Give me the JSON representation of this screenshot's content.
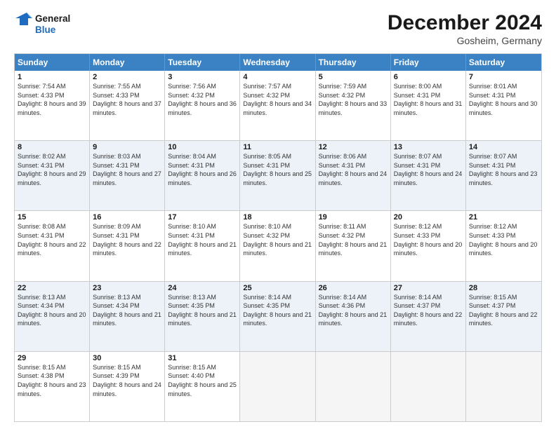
{
  "header": {
    "logo_general": "General",
    "logo_blue": "Blue",
    "month_title": "December 2024",
    "location": "Gosheim, Germany"
  },
  "calendar": {
    "days_of_week": [
      "Sunday",
      "Monday",
      "Tuesday",
      "Wednesday",
      "Thursday",
      "Friday",
      "Saturday"
    ],
    "weeks": [
      [
        {
          "day": "",
          "empty": true
        },
        {
          "day": "",
          "empty": true
        },
        {
          "day": "",
          "empty": true
        },
        {
          "day": "",
          "empty": true
        },
        {
          "day": "",
          "empty": true
        },
        {
          "day": "",
          "empty": true
        },
        {
          "day": "",
          "empty": true
        }
      ],
      [
        {
          "day": "1",
          "sunrise": "7:54 AM",
          "sunset": "4:33 PM",
          "daylight": "8 hours and 39 minutes."
        },
        {
          "day": "2",
          "sunrise": "7:55 AM",
          "sunset": "4:33 PM",
          "daylight": "8 hours and 37 minutes."
        },
        {
          "day": "3",
          "sunrise": "7:56 AM",
          "sunset": "4:32 PM",
          "daylight": "8 hours and 36 minutes."
        },
        {
          "day": "4",
          "sunrise": "7:57 AM",
          "sunset": "4:32 PM",
          "daylight": "8 hours and 34 minutes."
        },
        {
          "day": "5",
          "sunrise": "7:59 AM",
          "sunset": "4:32 PM",
          "daylight": "8 hours and 33 minutes."
        },
        {
          "day": "6",
          "sunrise": "8:00 AM",
          "sunset": "4:31 PM",
          "daylight": "8 hours and 31 minutes."
        },
        {
          "day": "7",
          "sunrise": "8:01 AM",
          "sunset": "4:31 PM",
          "daylight": "8 hours and 30 minutes."
        }
      ],
      [
        {
          "day": "8",
          "sunrise": "8:02 AM",
          "sunset": "4:31 PM",
          "daylight": "8 hours and 29 minutes."
        },
        {
          "day": "9",
          "sunrise": "8:03 AM",
          "sunset": "4:31 PM",
          "daylight": "8 hours and 27 minutes."
        },
        {
          "day": "10",
          "sunrise": "8:04 AM",
          "sunset": "4:31 PM",
          "daylight": "8 hours and 26 minutes."
        },
        {
          "day": "11",
          "sunrise": "8:05 AM",
          "sunset": "4:31 PM",
          "daylight": "8 hours and 25 minutes."
        },
        {
          "day": "12",
          "sunrise": "8:06 AM",
          "sunset": "4:31 PM",
          "daylight": "8 hours and 24 minutes."
        },
        {
          "day": "13",
          "sunrise": "8:07 AM",
          "sunset": "4:31 PM",
          "daylight": "8 hours and 24 minutes."
        },
        {
          "day": "14",
          "sunrise": "8:07 AM",
          "sunset": "4:31 PM",
          "daylight": "8 hours and 23 minutes."
        }
      ],
      [
        {
          "day": "15",
          "sunrise": "8:08 AM",
          "sunset": "4:31 PM",
          "daylight": "8 hours and 22 minutes."
        },
        {
          "day": "16",
          "sunrise": "8:09 AM",
          "sunset": "4:31 PM",
          "daylight": "8 hours and 22 minutes."
        },
        {
          "day": "17",
          "sunrise": "8:10 AM",
          "sunset": "4:31 PM",
          "daylight": "8 hours and 21 minutes."
        },
        {
          "day": "18",
          "sunrise": "8:10 AM",
          "sunset": "4:32 PM",
          "daylight": "8 hours and 21 minutes."
        },
        {
          "day": "19",
          "sunrise": "8:11 AM",
          "sunset": "4:32 PM",
          "daylight": "8 hours and 21 minutes."
        },
        {
          "day": "20",
          "sunrise": "8:12 AM",
          "sunset": "4:33 PM",
          "daylight": "8 hours and 20 minutes."
        },
        {
          "day": "21",
          "sunrise": "8:12 AM",
          "sunset": "4:33 PM",
          "daylight": "8 hours and 20 minutes."
        }
      ],
      [
        {
          "day": "22",
          "sunrise": "8:13 AM",
          "sunset": "4:34 PM",
          "daylight": "8 hours and 20 minutes."
        },
        {
          "day": "23",
          "sunrise": "8:13 AM",
          "sunset": "4:34 PM",
          "daylight": "8 hours and 21 minutes."
        },
        {
          "day": "24",
          "sunrise": "8:13 AM",
          "sunset": "4:35 PM",
          "daylight": "8 hours and 21 minutes."
        },
        {
          "day": "25",
          "sunrise": "8:14 AM",
          "sunset": "4:35 PM",
          "daylight": "8 hours and 21 minutes."
        },
        {
          "day": "26",
          "sunrise": "8:14 AM",
          "sunset": "4:36 PM",
          "daylight": "8 hours and 21 minutes."
        },
        {
          "day": "27",
          "sunrise": "8:14 AM",
          "sunset": "4:37 PM",
          "daylight": "8 hours and 22 minutes."
        },
        {
          "day": "28",
          "sunrise": "8:15 AM",
          "sunset": "4:37 PM",
          "daylight": "8 hours and 22 minutes."
        }
      ],
      [
        {
          "day": "29",
          "sunrise": "8:15 AM",
          "sunset": "4:38 PM",
          "daylight": "8 hours and 23 minutes."
        },
        {
          "day": "30",
          "sunrise": "8:15 AM",
          "sunset": "4:39 PM",
          "daylight": "8 hours and 24 minutes."
        },
        {
          "day": "31",
          "sunrise": "8:15 AM",
          "sunset": "4:40 PM",
          "daylight": "8 hours and 25 minutes."
        },
        {
          "day": "",
          "empty": true
        },
        {
          "day": "",
          "empty": true
        },
        {
          "day": "",
          "empty": true
        },
        {
          "day": "",
          "empty": true
        }
      ]
    ]
  }
}
